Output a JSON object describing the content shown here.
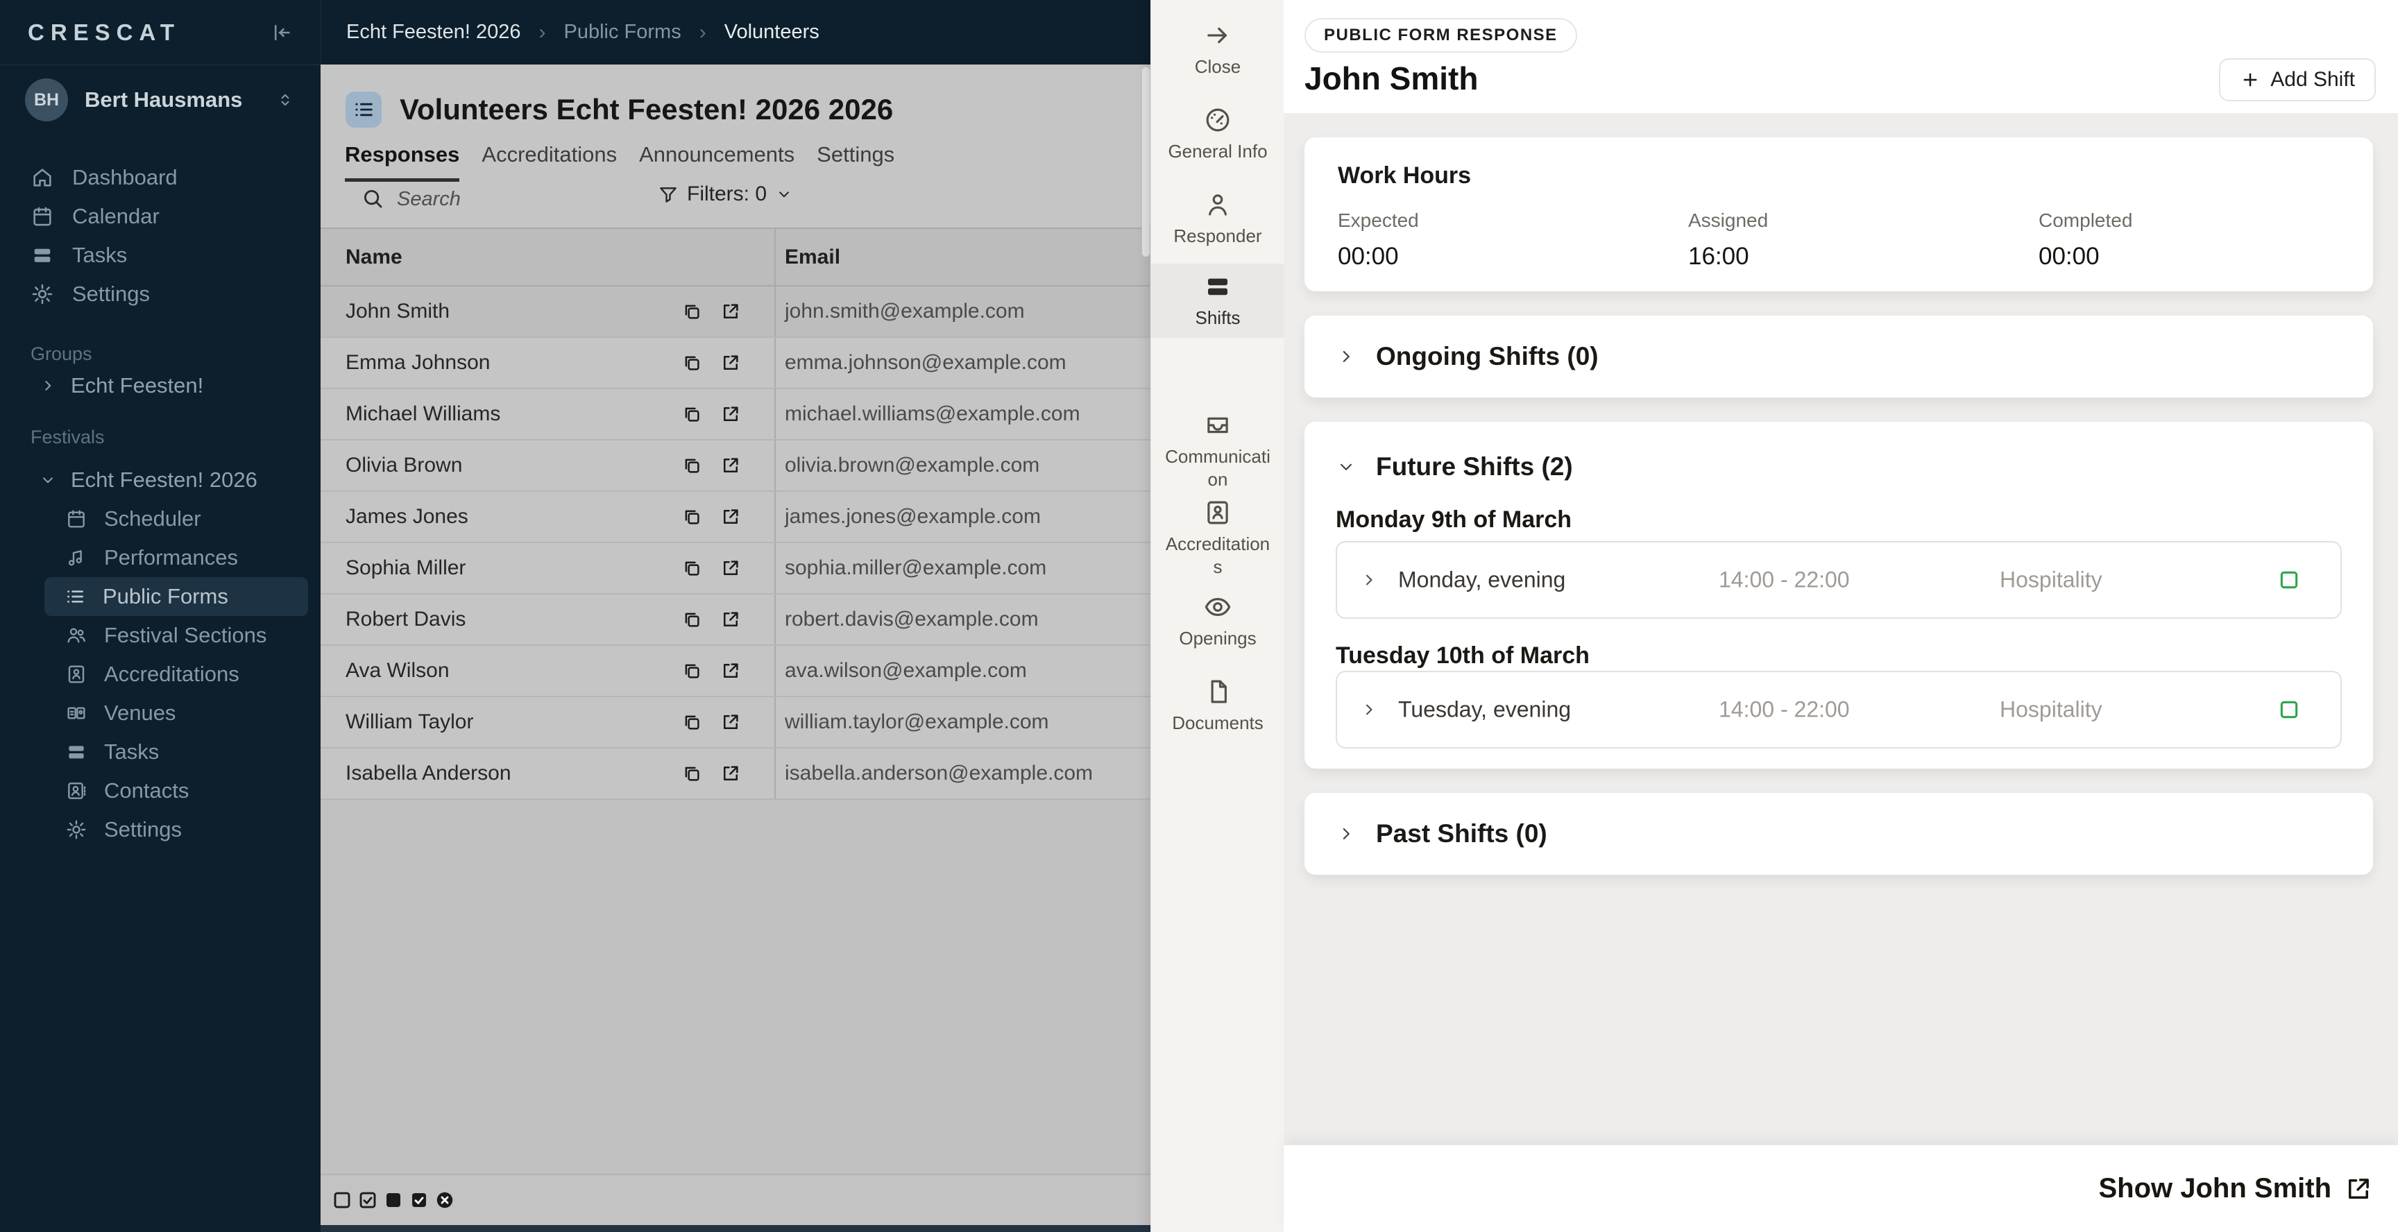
{
  "colors": {
    "sidebar_bg": "#0d1f2c",
    "sidebar_active_bg": "#1d3242",
    "accent_green": "#2aa64d",
    "drawer_nav_bg": "#f5f3f0",
    "dim_overlay": "#c5c5c6"
  },
  "app": {
    "logo": "CRESCAT"
  },
  "sidebar": {
    "user": {
      "initials": "BH",
      "name": "Bert Hausmans"
    },
    "items": [
      {
        "label": "Dashboard"
      },
      {
        "label": "Calendar"
      },
      {
        "label": "Tasks"
      },
      {
        "label": "Settings"
      }
    ],
    "groups_label": "Groups",
    "group_item": "Echt Feesten!",
    "festivals_label": "Festivals",
    "festival_item": "Echt Feesten! 2026",
    "festival_children": [
      {
        "label": "Scheduler"
      },
      {
        "label": "Performances"
      },
      {
        "label": "Public Forms"
      },
      {
        "label": "Festival Sections"
      },
      {
        "label": "Accreditations"
      },
      {
        "label": "Venues"
      },
      {
        "label": "Tasks"
      },
      {
        "label": "Contacts"
      },
      {
        "label": "Settings"
      }
    ]
  },
  "breadcrumb": {
    "separator": "›",
    "items": [
      "Echt Feesten! 2026",
      "Public Forms",
      "Volunteers"
    ]
  },
  "list_panel": {
    "title": "Volunteers Echt Feesten! 2026 2026",
    "tabs": [
      {
        "label": "Responses"
      },
      {
        "label": "Accreditations"
      },
      {
        "label": "Announcements"
      },
      {
        "label": "Settings"
      }
    ],
    "search_placeholder": "Search",
    "filters_label": "Filters: 0",
    "columns": {
      "name": "Name",
      "email": "Email"
    },
    "rows": [
      {
        "name": "John Smith",
        "email": "john.smith@example.com"
      },
      {
        "name": "Emma Johnson",
        "email": "emma.johnson@example.com"
      },
      {
        "name": "Michael Williams",
        "email": "michael.williams@example.com"
      },
      {
        "name": "Olivia Brown",
        "email": "olivia.brown@example.com"
      },
      {
        "name": "James Jones",
        "email": "james.jones@example.com"
      },
      {
        "name": "Sophia Miller",
        "email": "sophia.miller@example.com"
      },
      {
        "name": "Robert Davis",
        "email": "robert.davis@example.com"
      },
      {
        "name": "Ava Wilson",
        "email": "ava.wilson@example.com"
      },
      {
        "name": "William Taylor",
        "email": "william.taylor@example.com"
      },
      {
        "name": "Isabella Anderson",
        "email": "isabella.anderson@example.com"
      }
    ]
  },
  "drawer": {
    "nav": [
      {
        "label": "Close"
      },
      {
        "label": "General Info"
      },
      {
        "label": "Responder"
      },
      {
        "label": "Shifts"
      },
      {
        "label": "Communication"
      },
      {
        "label": "Accreditations"
      },
      {
        "label": "Openings"
      },
      {
        "label": "Documents"
      }
    ],
    "badge": "PUBLIC FORM RESPONSE",
    "title": "John Smith",
    "add_shift": "Add Shift",
    "work_hours": {
      "title": "Work Hours",
      "metrics": [
        {
          "label": "Expected",
          "value": "00:00"
        },
        {
          "label": "Assigned",
          "value": "16:00"
        },
        {
          "label": "Completed",
          "value": "00:00"
        }
      ]
    },
    "ongoing": {
      "title": "Ongoing Shifts (0)"
    },
    "future": {
      "title": "Future Shifts (2)",
      "groups": [
        {
          "date": "Monday 9th of March",
          "shifts": [
            {
              "name": "Monday, evening",
              "time": "14:00 - 22:00",
              "section": "Hospitality"
            }
          ]
        },
        {
          "date": "Tuesday 10th of March",
          "shifts": [
            {
              "name": "Tuesday, evening",
              "time": "14:00 - 22:00",
              "section": "Hospitality"
            }
          ]
        }
      ]
    },
    "past": {
      "title": "Past Shifts (0)"
    },
    "footer_link": "Show John Smith"
  }
}
